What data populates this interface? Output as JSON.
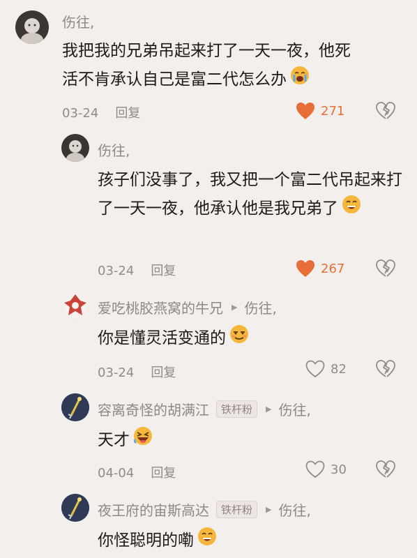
{
  "comments": [
    {
      "username": "伤往,",
      "text": "我把我的兄弟吊起来打了一天一夜，他死活不肯承认自己是富二代怎么办",
      "emoji": "crying-face",
      "date": "03-24",
      "reply_label": "回复",
      "likes": "271",
      "liked": true
    },
    {
      "username": "伤往,",
      "text": "孩子们没事了，我又把一个富二代吊起来打了一天一夜，他承认他是我兄弟了",
      "emoji": "grinning-face",
      "date": "03-24",
      "reply_label": "回复",
      "likes": "267",
      "liked": true
    },
    {
      "username": "爱吃桃胶燕窝的牛兄",
      "reply_to": "伤往,",
      "text": "你是懂灵活变通的",
      "emoji": "smirking-face",
      "date": "03-24",
      "reply_label": "回复",
      "likes": "82",
      "liked": false
    },
    {
      "username": "容离奇怪的胡满江",
      "badge": "铁杆粉",
      "reply_to": "伤往,",
      "text": "天才",
      "emoji": "laughing-face",
      "date": "04-04",
      "reply_label": "回复",
      "likes": "30",
      "liked": false
    },
    {
      "username": "夜王府的宙斯高达",
      "badge": "铁杆粉",
      "reply_to": "伤往,",
      "text": "你怪聪明的嘞",
      "emoji": "grinning-face"
    }
  ],
  "colors": {
    "accent": "#e76f37",
    "background": "#f2efec",
    "meta": "#8f8b88"
  }
}
